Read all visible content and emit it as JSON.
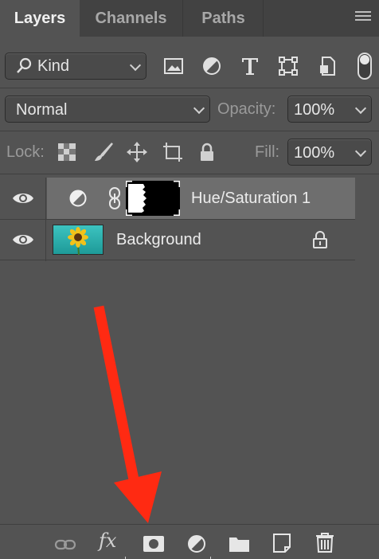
{
  "tabs": [
    {
      "label": "Layers",
      "active": true
    },
    {
      "label": "Channels",
      "active": false
    },
    {
      "label": "Paths",
      "active": false
    }
  ],
  "filter": {
    "kind_label": "Kind",
    "icons": [
      "image-filter-icon",
      "adjustment-filter-icon",
      "type-filter-icon",
      "shape-filter-icon",
      "smart-object-filter-icon"
    ]
  },
  "blend": {
    "mode": "Normal",
    "opacity_label": "Opacity:",
    "opacity_value": "100%"
  },
  "lock": {
    "label": "Lock:",
    "fill_label": "Fill:",
    "fill_value": "100%"
  },
  "layers": [
    {
      "name": "Hue/Saturation 1",
      "selected": true,
      "visible": true,
      "type": "adjustment"
    },
    {
      "name": "Background",
      "selected": false,
      "visible": true,
      "locked": true
    }
  ],
  "bottom_toolbar": {
    "fx_label": "fx",
    "icons": [
      "link-layers-icon",
      "layer-style-icon",
      "add-mask-icon",
      "new-adjustment-layer-icon",
      "new-group-icon",
      "new-layer-icon",
      "delete-layer-icon"
    ]
  },
  "colors": {
    "panel_bg": "#535353",
    "selected_row": "#6e6e6e",
    "annotation_arrow": "#ff2a12"
  }
}
